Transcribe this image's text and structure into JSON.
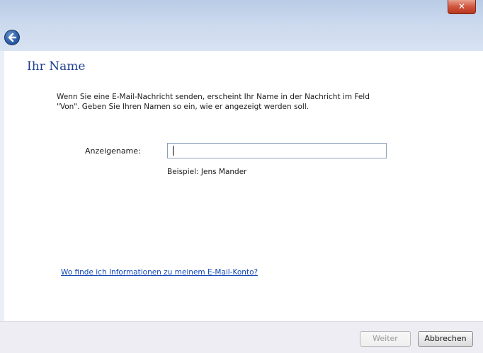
{
  "titlebar": {
    "close_label": "✕"
  },
  "page": {
    "title": "Ihr Name",
    "description_line1": "Wenn Sie eine E-Mail-Nachricht senden, erscheint Ihr Name in der Nachricht im Feld",
    "description_line2": "\"Von\". Geben Sie Ihren Namen so ein, wie er angezeigt werden soll.",
    "display_name_label": "Anzeigename:",
    "display_name_value": "",
    "display_name_placeholder": "",
    "example_text": "Beispiel: Jens Mander",
    "help_link": "Wo finde ich Informationen zu meinem E-Mail-Konto?"
  },
  "footer": {
    "next_label": "Weiter",
    "cancel_label": "Abbrechen"
  },
  "colors": {
    "title": "#1f3f8f",
    "link": "#1448b8",
    "close": "#d0553d"
  },
  "icons": {
    "back": "back-arrow-icon",
    "close": "close-icon"
  }
}
